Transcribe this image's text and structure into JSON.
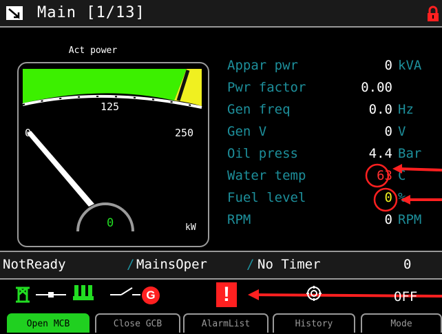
{
  "header": {
    "title": "Main [1/13]"
  },
  "gauge": {
    "label": "Act power",
    "value": "0",
    "unit": "kW",
    "ticks": {
      "min": "0",
      "mid": "125",
      "max": "250"
    },
    "reading": 0,
    "range": [
      0,
      250
    ],
    "colors": {
      "green_band": "#3cf000",
      "yellow_band": "#f0f020",
      "needle": "#ffffff"
    }
  },
  "values": [
    {
      "label": "Appar pwr",
      "value": "0",
      "unit": "kVA"
    },
    {
      "label": "Pwr factor",
      "value": "0.00",
      "unit": ""
    },
    {
      "label": "Gen freq",
      "value": "0.0",
      "unit": "Hz"
    },
    {
      "label": "Gen V",
      "value": "0",
      "unit": "V"
    },
    {
      "label": "Oil press",
      "value": "4.4",
      "unit": "Bar"
    },
    {
      "label": "Water temp",
      "value": "63",
      "unit": "C",
      "value_color": "#ff3030"
    },
    {
      "label": "Fuel level",
      "value": "0",
      "unit": "%",
      "value_color": "#f0f020"
    },
    {
      "label": "RPM",
      "value": "0",
      "unit": "RPM"
    }
  ],
  "status": {
    "state": "NotReady",
    "mode": "MainsOper",
    "timer": "No Timer",
    "timer_value": "0",
    "sep": "/"
  },
  "icons": {
    "mode_text": "OFF",
    "gen_badge": "G",
    "alarm_badge": "!"
  },
  "softkeys": [
    {
      "label": "Open MCB",
      "active": true
    },
    {
      "label": "Close GCB",
      "active": false
    },
    {
      "label": "AlarmList",
      "active": false
    },
    {
      "label": "History",
      "active": false
    },
    {
      "label": "Mode",
      "active": false
    }
  ]
}
